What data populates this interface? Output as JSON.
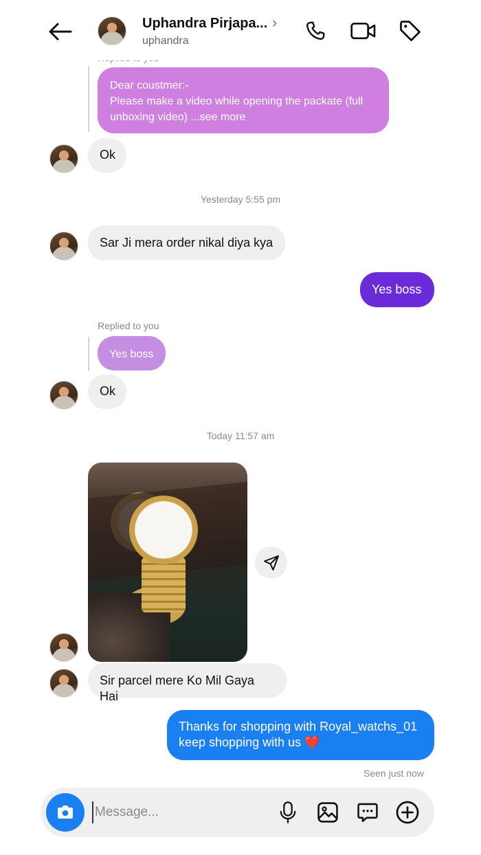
{
  "header": {
    "back_icon": "arrow-left-icon",
    "name": "Uphandra Pirjapa...",
    "username": "uphandra",
    "chevron": "›",
    "actions": [
      "phone-icon",
      "video-icon",
      "tag-icon"
    ]
  },
  "messages": {
    "replied_label_top": "Replied to you",
    "reply_1": "Dear coustmer:-\nPlease make a video while opening the packate (full unboxing video) ...see more",
    "reply_1_line1": "Dear coustmer:-",
    "reply_1_line2": "Please make a video while opening the packate (full",
    "reply_1_line3": "unboxing video) ...see more",
    "ok_1": "Ok",
    "timestamp_1": "Yesterday 5:55 pm",
    "incoming_2": "Sar Ji mera order nikal diya kya",
    "outgoing_1": "Yes boss",
    "replied_label_2": "Replied to you",
    "reply_2": "Yes boss",
    "ok_2": "Ok",
    "timestamp_2": "Today 11:57 am",
    "incoming_3": "Sir parcel mere Ko Mil Gaya Hai",
    "outgoing_2_line1": "Thanks for shopping with Royal_watchs_01",
    "outgoing_2_line2": "keep shopping with us ❤️",
    "seen": "Seen just now"
  },
  "composer": {
    "placeholder": "Message...",
    "actions": [
      "camera-icon",
      "microphone-icon",
      "gallery-icon",
      "sticker-icon",
      "plus-icon"
    ]
  },
  "colors": {
    "accent_blue": "#1a7ff0",
    "purple": "#6c2bd9",
    "reply_pink": "#cf7fe0",
    "reply_lilac": "#c58ee3"
  }
}
